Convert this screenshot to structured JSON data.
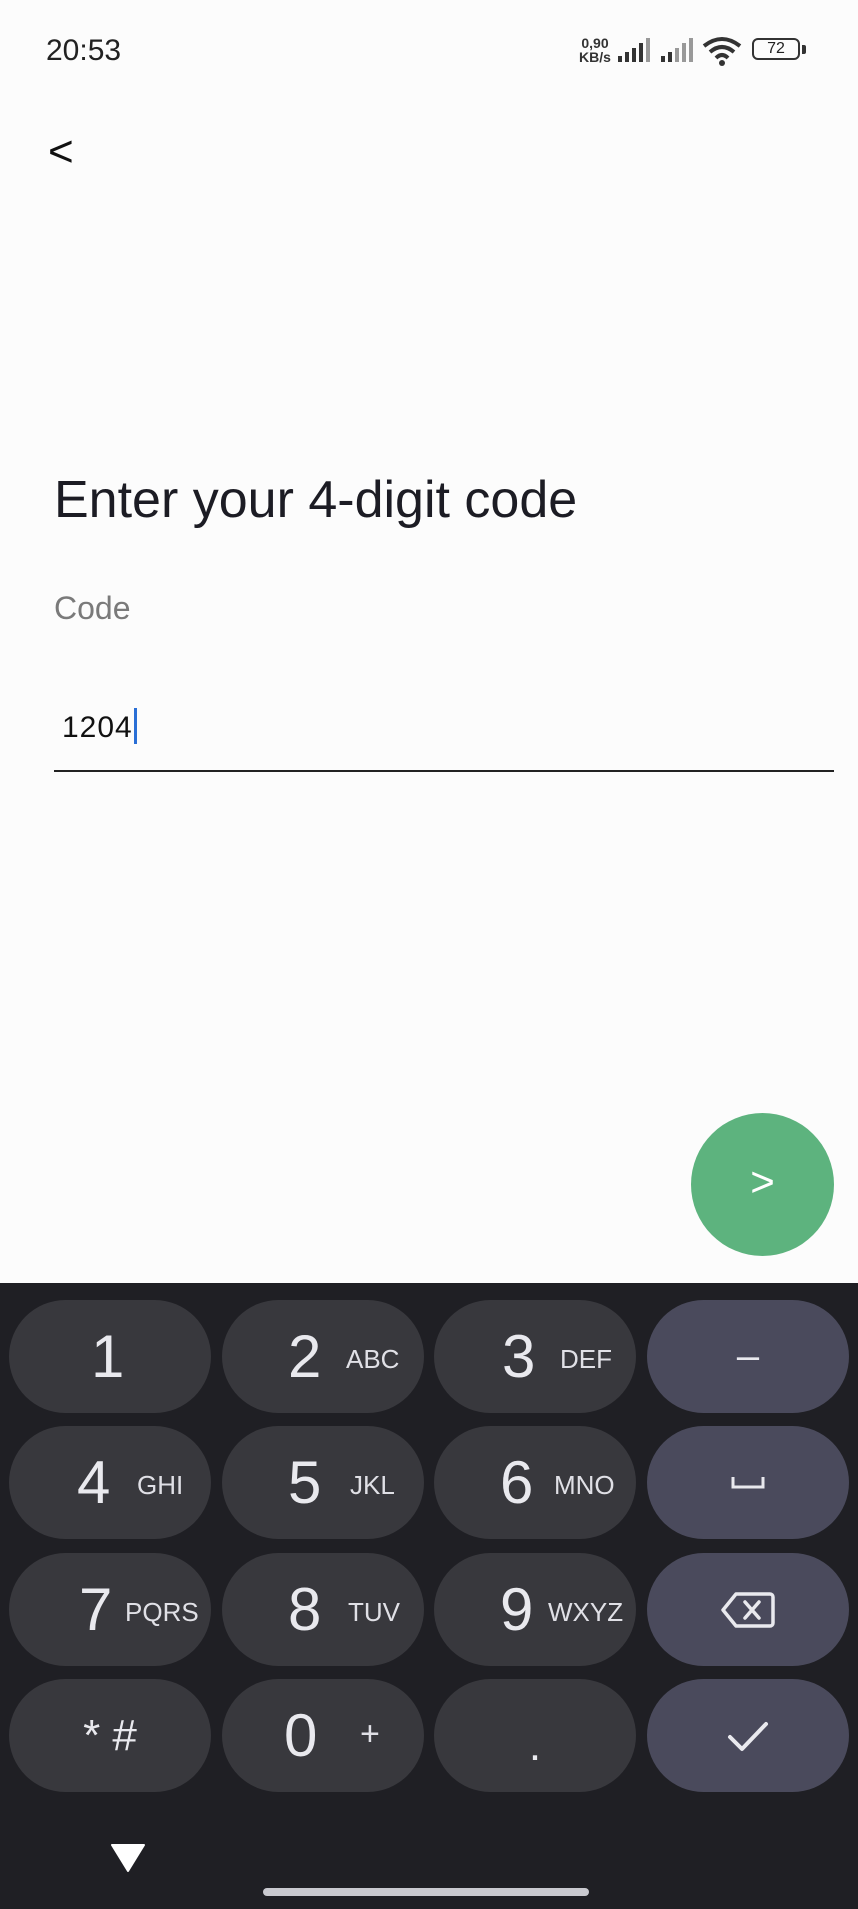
{
  "status_bar": {
    "time": "20:53",
    "net_speed_value": "0,90",
    "net_speed_unit": "KB/s",
    "battery_level": "72"
  },
  "header": {
    "back_label": "<"
  },
  "main": {
    "title": "Enter your 4-digit code",
    "field_label": "Code",
    "code_value": "1204"
  },
  "next_button": {
    "label": ">"
  },
  "keyboard": {
    "keys": [
      {
        "digit": "1",
        "letters": ""
      },
      {
        "digit": "2",
        "letters": "ABC"
      },
      {
        "digit": "3",
        "letters": "DEF"
      },
      {
        "digit": "4",
        "letters": "GHI"
      },
      {
        "digit": "5",
        "letters": "JKL"
      },
      {
        "digit": "6",
        "letters": "MNO"
      },
      {
        "digit": "7",
        "letters": "PQRS"
      },
      {
        "digit": "8",
        "letters": "TUV"
      },
      {
        "digit": "9",
        "letters": "WXYZ"
      },
      {
        "digit": "* #",
        "letters": ""
      },
      {
        "digit": "0",
        "letters": "+"
      },
      {
        "digit": ".",
        "letters": ""
      }
    ],
    "minus_label": "–",
    "space_icon": "space-icon",
    "backspace_icon": "backspace-icon",
    "done_icon": "check-icon"
  },
  "colors": {
    "accent_green": "#5db37e",
    "keyboard_bg": "#1f1f24",
    "key_bg": "#38383d",
    "action_key_bg": "#4a4a5c",
    "caret": "#2a6fd6"
  }
}
